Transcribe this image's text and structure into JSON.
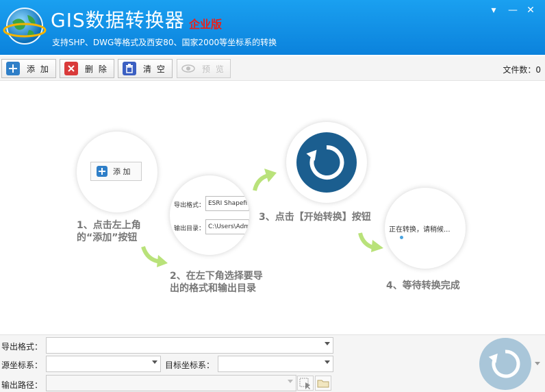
{
  "title": {
    "app_name": "GIS数据转换器",
    "edition": "企业版",
    "subtitle": "支持SHP、DWG等格式及西安80、国家2000等坐标系的转换"
  },
  "window": {
    "dropdown_glyph": "▾",
    "minimize_glyph": "—",
    "close_glyph": "✕"
  },
  "toolbar": {
    "add_label": "添 加",
    "delete_label": "删 除",
    "clear_label": "清 空",
    "preview_label": "预 览",
    "file_count": "文件数：0"
  },
  "guide": {
    "step1_button_label": "添 加",
    "step1_text_line1": "1、点击左上角",
    "step1_text_line2": "的“添加”按钮",
    "step2_label_format": "导出格式：",
    "step2_value_format": "ESRI Shapefile",
    "step2_label_dir": "输出目录：",
    "step2_value_dir": "C:\\Users\\Adm",
    "step2_text_line1": "2、在左下角选择要导",
    "step2_text_line2": "出的格式和输出目录",
    "step3_text": "3、点击【开始转换】按钮",
    "step4_status": "正在转换，请稍候...",
    "step4_text": "4、等待转换完成"
  },
  "form": {
    "export_format_label": "导出格式：",
    "source_crs_label": "源坐标系：",
    "target_crs_label": "目标坐标系：",
    "output_path_label": "输出路径："
  },
  "colors": {
    "title_bar": "#0b82dc",
    "edition_red": "#e8201a",
    "start_button": "#1b5e8f",
    "arrow_green": "#b9e27a"
  },
  "icons": {
    "add": "plus-icon",
    "delete": "x-icon",
    "clear": "trash-icon",
    "preview": "eye-icon",
    "start": "refresh-icon"
  }
}
